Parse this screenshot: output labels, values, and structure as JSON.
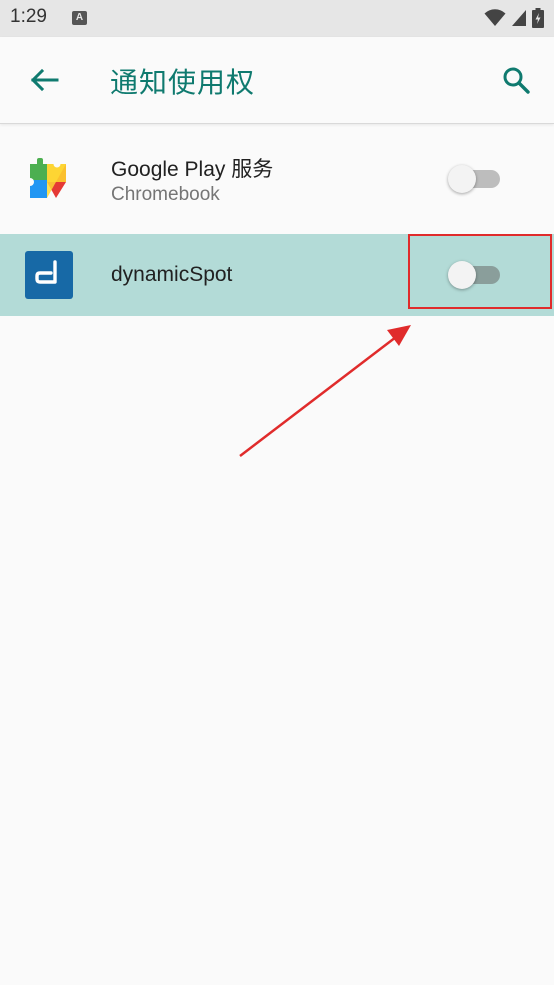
{
  "status_bar": {
    "time": "1:29",
    "notification_letter": "A",
    "icons": [
      "wifi-icon",
      "signal-icon",
      "battery-charging-icon"
    ]
  },
  "app_bar": {
    "title": "通知使用权",
    "back_icon": "arrow-back-icon",
    "search_icon": "search-icon",
    "accent_color": "#0f7a6f"
  },
  "apps": [
    {
      "name": "Google Play 服务",
      "subtitle": "Chromebook",
      "icon": "google-play-services-icon",
      "enabled": false
    },
    {
      "name": "dynamicSpot",
      "icon": "dynamicspot-icon",
      "enabled": false,
      "highlighted": true
    }
  ],
  "annotation": {
    "color": "#e02b2b"
  }
}
